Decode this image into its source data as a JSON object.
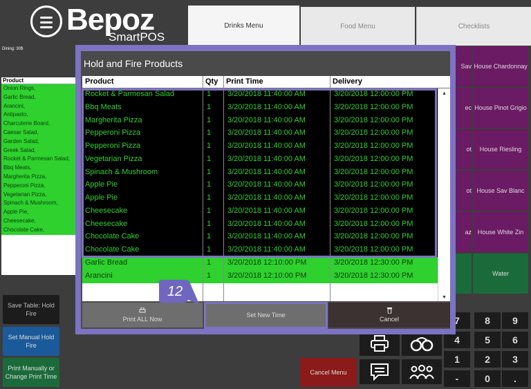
{
  "brand": {
    "name": "Bepoz",
    "subtitle": "SmartPOS"
  },
  "tabs": [
    "Drinks Menu",
    "Food Menu",
    "Checklists"
  ],
  "dining_label": "Dining: 30$",
  "order": {
    "header": "Product",
    "items": [
      "Onion Rings,",
      "Garlic Bread,",
      "Arancini,",
      "Antipasto,",
      "Charcuterie Board,",
      "Caesar Salad,",
      "Garden Salad,",
      "Greek Salad,",
      "Rocket & Parmesan Salad,",
      "Bbq Meats,",
      "Margherita Pizza,",
      "Pepperoni Pizza,",
      "Vegetarian Pizza,",
      "Spinach & Mushroom,",
      "Apple Pie,",
      "Cheesecake,",
      "Chocolate Cake,"
    ]
  },
  "left_buttons": {
    "save_table": "Save Table: Hold Fire",
    "set_manual": "Set Manual Hold Fire",
    "print_manually": "Print Manually or Change Print Time"
  },
  "right_buttons": [
    "House Chardonnay",
    "House Pinot Grigio",
    "House Riesling",
    "House Sav Blanc",
    "House White Zin",
    "Water"
  ],
  "slivers": [
    "Sav",
    "ec",
    "ot",
    "ot",
    "az",
    ""
  ],
  "keypad": [
    "7",
    "8",
    "9",
    "4",
    "5",
    "6",
    "1",
    "2",
    "3",
    "-",
    "0",
    "."
  ],
  "cancel_menu": "Cancel Menu",
  "modal": {
    "title": "Hold and Fire Products",
    "columns": [
      "Product",
      "Qty",
      "Print Time",
      "Delivery"
    ],
    "held_rows": [
      [
        "Rocket & Parmesan Salad",
        "1",
        "3/20/2018 11:40:00 AM",
        "3/20/2018 12:00:00 PM"
      ],
      [
        "Bbq Meats",
        "1",
        "3/20/2018 11:40:00 AM",
        "3/20/2018 12:00:00 PM"
      ],
      [
        "Margherita Pizza",
        "1",
        "3/20/2018 11:40:00 AM",
        "3/20/2018 12:00:00 PM"
      ],
      [
        "Pepperoni Pizza",
        "1",
        "3/20/2018 11:40:00 AM",
        "3/20/2018 12:00:00 PM"
      ],
      [
        "Pepperoni Pizza",
        "1",
        "3/20/2018 11:40:00 AM",
        "3/20/2018 12:00:00 PM"
      ],
      [
        "Vegetarian Pizza",
        "1",
        "3/20/2018 11:40:00 AM",
        "3/20/2018 12:00:00 PM"
      ],
      [
        "Spinach & Mushroom",
        "1",
        "3/20/2018 11:40:00 AM",
        "3/20/2018 12:00:00 PM"
      ],
      [
        "Apple Pie",
        "1",
        "3/20/2018 11:40:00 AM",
        "3/20/2018 12:00:00 PM"
      ],
      [
        "Apple Pie",
        "1",
        "3/20/2018 11:40:00 AM",
        "3/20/2018 12:00:00 PM"
      ],
      [
        "Cheesecake",
        "1",
        "3/20/2018 11:40:00 AM",
        "3/20/2018 12:00:00 PM"
      ],
      [
        "Cheesecake",
        "1",
        "3/20/2018 11:40:00 AM",
        "3/20/2018 12:00:00 PM"
      ],
      [
        "Chocolate Cake",
        "1",
        "3/20/2018 11:40:00 AM",
        "3/20/2018 12:00:00 PM"
      ],
      [
        "Chocolate Cake",
        "1",
        "3/20/2018 11:40:00 AM",
        "3/20/2018 12:00:00 PM"
      ]
    ],
    "other_rows": [
      [
        "Garlic Bread",
        "1",
        "3/20/2018 12:10:00 PM",
        "3/20/2018 12:30:00 PM"
      ],
      [
        "Arancini",
        "1",
        "3/20/2018 12:10:00 PM",
        "3/20/2018 12:30:00 PM"
      ]
    ],
    "buttons": {
      "print_all": "Print ALL Now",
      "set_new_time": "Set New Time",
      "cancel": "Cancel"
    }
  },
  "callout_number": "12",
  "colors": {
    "accent": "#7c73c3",
    "held_text": "#2ed12e",
    "purple_button": "#6b1a64",
    "cancel_red": "#8b1a1a",
    "blue_button": "#1a5a9a",
    "green_button": "#1b6b3a"
  }
}
